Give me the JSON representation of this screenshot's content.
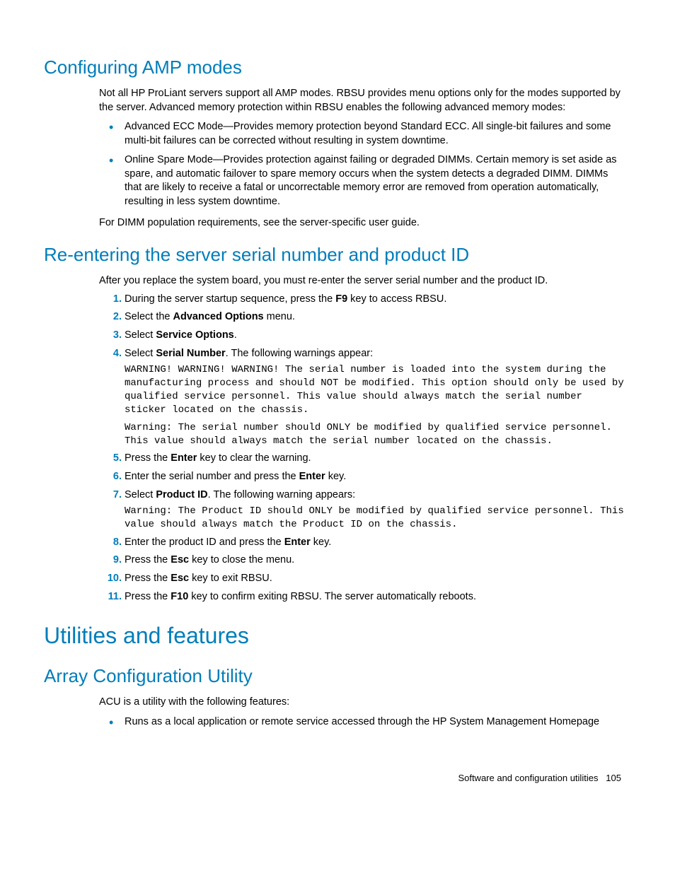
{
  "section1": {
    "heading": "Configuring AMP modes",
    "intro": "Not all HP ProLiant servers support all AMP modes. RBSU provides menu options only for the modes supported by the server. Advanced memory protection within RBSU enables the following advanced memory modes:",
    "bullets": [
      "Advanced ECC Mode—Provides memory protection beyond Standard ECC. All single-bit failures and some multi-bit failures can be corrected without resulting in system downtime.",
      "Online Spare Mode—Provides protection against failing or degraded DIMMs. Certain memory is set aside as spare, and automatic failover to spare memory occurs when the system detects a degraded DIMM. DIMMs that are likely to receive a fatal or uncorrectable memory error are removed from operation automatically, resulting in less system downtime."
    ],
    "outro": "For DIMM population requirements, see the server-specific user guide."
  },
  "section2": {
    "heading": "Re-entering the server serial number and product ID",
    "intro": "After you replace the system board, you must re-enter the server serial number and the product ID.",
    "steps": {
      "s1_a": "During the server startup sequence, press the ",
      "s1_b": "F9",
      "s1_c": " key to access RBSU.",
      "s2_a": "Select the ",
      "s2_b": "Advanced Options",
      "s2_c": " menu.",
      "s3_a": "Select ",
      "s3_b": "Service Options",
      "s3_c": ".",
      "s4_a": "Select ",
      "s4_b": "Serial Number",
      "s4_c": ". The following warnings appear:",
      "s4_warn1": "WARNING! WARNING! WARNING! The serial number is loaded into the system during the manufacturing process and should NOT be modified. This option should only be used by qualified service personnel. This value should always match the serial number sticker located on the chassis.",
      "s4_warn2": "Warning: The serial number should ONLY be modified by qualified service personnel. This value should always match the serial number located on the chassis.",
      "s5_a": "Press the ",
      "s5_b": "Enter",
      "s5_c": " key to clear the warning.",
      "s6_a": "Enter the serial number and press the ",
      "s6_b": "Enter",
      "s6_c": " key.",
      "s7_a": "Select ",
      "s7_b": "Product ID",
      "s7_c": ". The following warning appears:",
      "s7_warn": "Warning: The Product ID should ONLY be modified by qualified service personnel. This value should always match the Product ID on the chassis.",
      "s8_a": "Enter the product ID and press the ",
      "s8_b": "Enter",
      "s8_c": " key.",
      "s9_a": "Press the ",
      "s9_b": "Esc",
      "s9_c": " key to close the menu.",
      "s10_a": "Press the ",
      "s10_b": "Esc",
      "s10_c": " key to exit RBSU.",
      "s11_a": "Press the ",
      "s11_b": "F10",
      "s11_c": " key to confirm exiting RBSU. The server automatically reboots."
    }
  },
  "section3": {
    "heading": "Utilities and features"
  },
  "section4": {
    "heading": "Array Configuration Utility",
    "intro": "ACU is a utility with the following features:",
    "bullets": [
      "Runs as a local application or remote service accessed through the HP System Management Homepage"
    ]
  },
  "footer": {
    "text": "Software and configuration utilities",
    "page": "105"
  }
}
